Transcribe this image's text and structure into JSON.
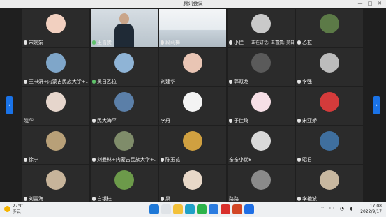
{
  "window": {
    "title": "腾讯会议",
    "min": "—",
    "max": "□",
    "close": "✕"
  },
  "nav": {
    "prev": "‹",
    "next": "›"
  },
  "speaking_text": "正在讲话: 王喜贵; 吴日乙拉",
  "tiles": [
    {
      "name": "宋婉娟",
      "mic": "off",
      "kind": "avatar",
      "av": "#f2d0c0"
    },
    {
      "name": "王喜贵",
      "mic": "on",
      "kind": "video",
      "av": "#9aa6ad"
    },
    {
      "name": "段莉梅",
      "mic": "off",
      "kind": "room",
      "av": "#dfe5ea"
    },
    {
      "name": "小佳",
      "mic": "off",
      "kind": "avatar",
      "av": "#c9c9c9"
    },
    {
      "name": "乙拉",
      "mic": "off",
      "kind": "avatar",
      "av": "#5c7a47"
    },
    {
      "name": "王书妍+内蒙古民族大学+...",
      "mic": "off",
      "kind": "avatar",
      "av": "#7fa6c9"
    },
    {
      "name": "吴日乙拉",
      "mic": "on",
      "kind": "avatar",
      "av": "#8fb4d6"
    },
    {
      "name": "刘建华",
      "mic": "none",
      "kind": "avatar",
      "av": "#e9c5b4"
    },
    {
      "name": "郭双龙",
      "mic": "off",
      "kind": "avatar",
      "av": "#5a5a5a"
    },
    {
      "name": "李强",
      "mic": "off",
      "kind": "avatar",
      "av": "#bcbcbc"
    },
    {
      "name": "晓华",
      "mic": "none",
      "kind": "avatar",
      "av": "#e6d6cc"
    },
    {
      "name": "民大海平",
      "mic": "off",
      "kind": "avatar",
      "av": "#5b7fa8"
    },
    {
      "name": "李丹",
      "mic": "none",
      "kind": "avatar",
      "av": "#f4f4f4"
    },
    {
      "name": "于佳琦",
      "mic": "off",
      "kind": "avatar",
      "av": "#f6dfe6"
    },
    {
      "name": "宋亚娇",
      "mic": "off",
      "kind": "avatar",
      "av": "#d43b3b"
    },
    {
      "name": "徐宁",
      "mic": "off",
      "kind": "avatar",
      "av": "#b8a078"
    },
    {
      "name": "刘曼林+内蒙古民族大学+...",
      "mic": "off",
      "kind": "avatar",
      "av": "#7f8c6a"
    },
    {
      "name": "陈玉花",
      "mic": "off",
      "kind": "avatar",
      "av": "#d0a040"
    },
    {
      "name": "亲亲小优8",
      "mic": "none",
      "kind": "avatar",
      "av": "#d9d9d9"
    },
    {
      "name": "昭日",
      "mic": "off",
      "kind": "avatar",
      "av": "#3f6f9e"
    },
    {
      "name": "刘雯海",
      "mic": "off",
      "kind": "avatar",
      "av": "#c7b49a"
    },
    {
      "name": "白银柱",
      "mic": "off",
      "kind": "avatar",
      "av": "#6c9a4a"
    },
    {
      "name": "泉",
      "mic": "off",
      "kind": "avatar",
      "av": "#e8d8c8"
    },
    {
      "name": "路路",
      "mic": "none",
      "kind": "avatar",
      "av": "#8a8a8a"
    },
    {
      "name": "李艳波",
      "mic": "off",
      "kind": "avatar",
      "av": "#c8b8a0"
    }
  ],
  "taskbar": {
    "temp": "27°C",
    "cond": "多云",
    "ime": "中",
    "time": "17:08",
    "date": "2022/9/17",
    "apps": [
      {
        "icon": "start-icon",
        "color": "#1e78d7"
      },
      {
        "icon": "search-icon",
        "color": "#dfe3e7"
      },
      {
        "icon": "folder-icon",
        "color": "#f3c13a"
      },
      {
        "icon": "edge-icon",
        "color": "#1fa0c8"
      },
      {
        "icon": "wechat-icon",
        "color": "#2bb34a"
      },
      {
        "icon": "meeting-icon",
        "color": "#2b7ce0"
      },
      {
        "icon": "wps-icon",
        "color": "#d9302c"
      },
      {
        "icon": "ppt-icon",
        "color": "#d24726"
      },
      {
        "icon": "tencent-meeting-icon",
        "color": "#1f6fe5"
      }
    ]
  }
}
